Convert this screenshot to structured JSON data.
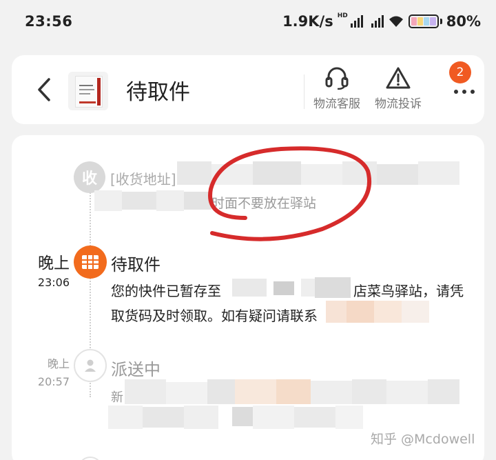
{
  "status_bar": {
    "time": "23:56",
    "net_speed": "1.9K/s",
    "hd_label": "HD",
    "battery": "80%",
    "icons": [
      "signal-hd-icon",
      "signal-icon",
      "wifi-icon",
      "battery-icon"
    ]
  },
  "header": {
    "back_icon": "chevron-left-icon",
    "title": "待取件",
    "actions": [
      {
        "label": "物流客服",
        "icon": "headset-icon"
      },
      {
        "label": "物流投诉",
        "icon": "warning-triangle-icon"
      }
    ],
    "more_icon": "more-dots-icon",
    "more_badge": "2",
    "accent_color": "#f26b1d"
  },
  "timeline": {
    "address": {
      "node_label": "收",
      "line1_prefix": "[收货地址] ",
      "line2_text": "时面不要放在驿站"
    },
    "pickup": {
      "date": "晚上",
      "time": "23:06",
      "title": "待取件",
      "node_icon": "grid-box-icon",
      "message_part1": "您的快件已暂存至",
      "message_part1b": "店菜鸟驿站，请凭",
      "message_part2": "取货码及时领取。如有疑问请联系"
    },
    "delivering": {
      "date": "晚上",
      "time": "20:57",
      "title": "派送中",
      "node_icon": "courier-person-icon",
      "message_prefix": "新"
    }
  },
  "annotation_color": "#d62b2b",
  "watermark": "知乎 @Mcdowell"
}
